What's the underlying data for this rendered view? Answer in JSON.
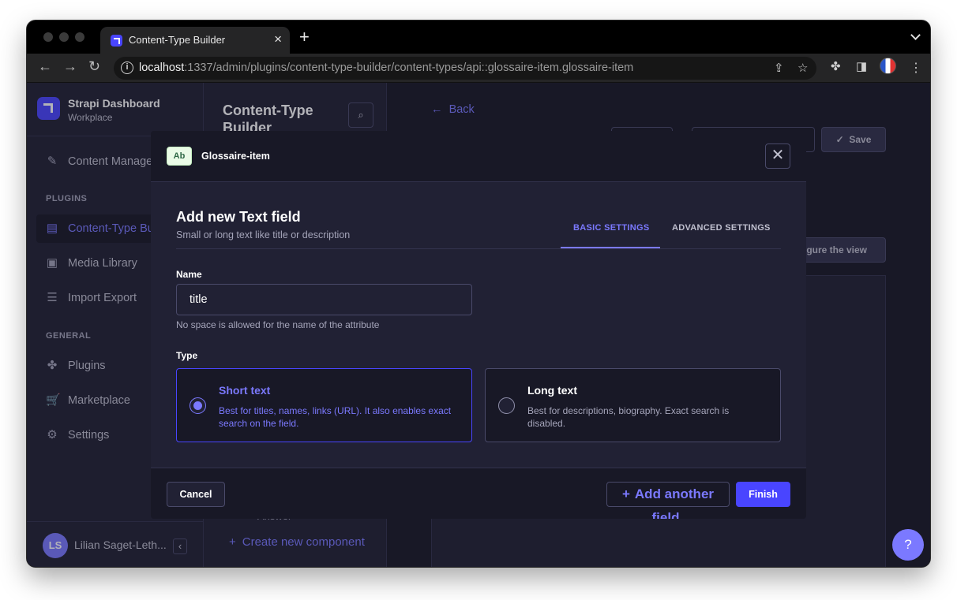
{
  "browser": {
    "tab_title": "Content-Type Builder",
    "tab_close": "×",
    "new_tab": "+",
    "url_host": "localhost",
    "url_rest": ":1337/admin/plugins/content-type-builder/content-types/api::glossaire-item.glossaire-item",
    "back_glyph": "←",
    "forward_glyph": "→",
    "reload_glyph": "↻",
    "info_glyph": "i",
    "share_glyph": "⇪",
    "star_glyph": "☆",
    "extensions_glyph": "✤",
    "sidepanel_glyph": "◨",
    "menu_glyph": "⋮"
  },
  "sidebar": {
    "brand_name": "Strapi Dashboard",
    "brand_sub": "Workplace",
    "items": [
      {
        "label": "Content Manager",
        "icon": "pencil-icon",
        "glyph": "✎"
      },
      {
        "label": "Content-Type Builder",
        "icon": "layout-icon",
        "glyph": "▤"
      },
      {
        "label": "Media Library",
        "icon": "image-icon",
        "glyph": "▣"
      },
      {
        "label": "Import Export",
        "icon": "database-icon",
        "glyph": "☰"
      },
      {
        "label": "Plugins",
        "icon": "puzzle-icon",
        "glyph": "✤"
      },
      {
        "label": "Marketplace",
        "icon": "cart-icon",
        "glyph": "🛒"
      },
      {
        "label": "Settings",
        "icon": "gear-icon",
        "glyph": "⚙"
      }
    ],
    "section_plugins": "PLUGINS",
    "section_general": "GENERAL",
    "user_initials": "LS",
    "user_name": "Lilian Saget-Leth...",
    "collapse_glyph": "‹"
  },
  "subnav": {
    "title": "Content-Type Builder",
    "search_glyph": "⌕",
    "partial_item": "Answer",
    "create_component": "Create new component",
    "create_glyph": "+"
  },
  "main": {
    "back_label": "Back",
    "back_glyph": "←",
    "save_label": "Save",
    "save_glyph": "✓",
    "configure_partial": "figure the view"
  },
  "modal": {
    "badge": "Ab",
    "breadcrumb": "Glossaire-item",
    "close_glyph": "✕",
    "title": "Add new Text field",
    "subtitle": "Small or long text like title or description",
    "tabs": [
      "BASIC SETTINGS",
      "ADVANCED SETTINGS"
    ],
    "name_label": "Name",
    "name_value": "title",
    "name_hint": "No space is allowed for the name of the attribute",
    "type_label": "Type",
    "types": [
      {
        "title": "Short text",
        "desc": "Best for titles, names, links (URL). It also enables exact search on the field.",
        "selected": true
      },
      {
        "title": "Long text",
        "desc": "Best for descriptions, biography. Exact search is disabled.",
        "selected": false
      }
    ],
    "cancel_label": "Cancel",
    "add_another_label": "Add another field",
    "add_glyph": "+",
    "finish_label": "Finish"
  },
  "help_glyph": "?",
  "colors": {
    "primary": "#4945ff",
    "primary_light": "#7b79ff",
    "background": "#181826",
    "surface": "#212134",
    "border": "#4a4a6a"
  }
}
